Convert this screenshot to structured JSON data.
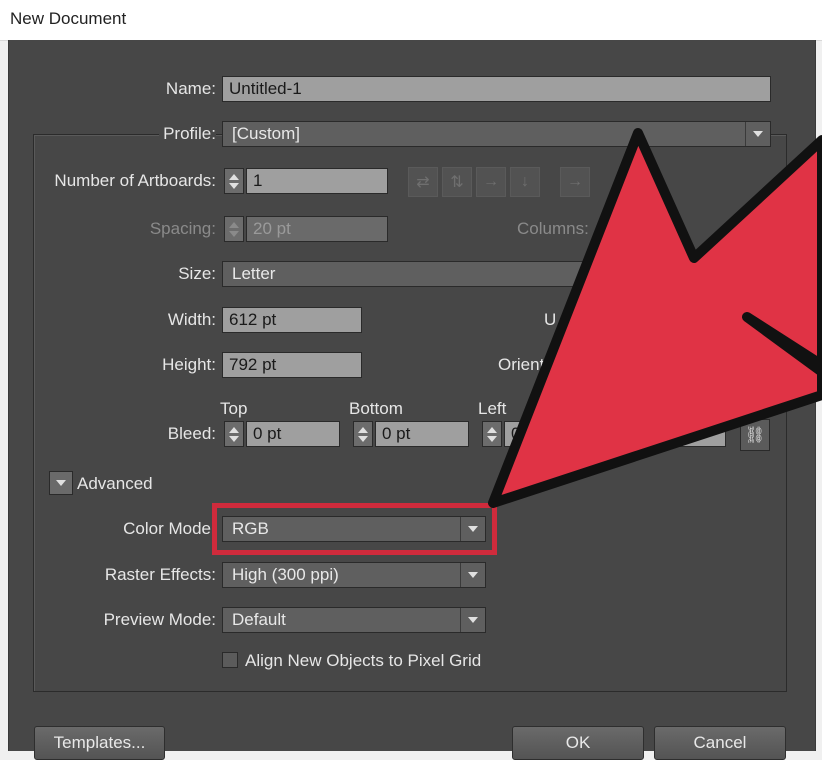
{
  "window": {
    "title": "New Document"
  },
  "name": {
    "label": "Name:",
    "value": "Untitled-1"
  },
  "profile": {
    "label": "Profile:",
    "value": "[Custom]"
  },
  "artboards": {
    "label": "Number of Artboards:",
    "value": "1"
  },
  "spacing": {
    "label": "Spacing:",
    "value": "20 pt"
  },
  "columns": {
    "label": "Columns:"
  },
  "size": {
    "label": "Size:",
    "value": "Letter"
  },
  "width": {
    "label": "Width:",
    "value": "612 pt"
  },
  "units": {
    "label_partial": "U"
  },
  "height": {
    "label": "Height:",
    "value": "792 pt"
  },
  "orientation": {
    "label_partial": "Orient"
  },
  "bleed": {
    "label": "Bleed:",
    "top_label": "Top",
    "top_value": "0 pt",
    "bottom_label": "Bottom",
    "bottom_value": "0 pt",
    "left_label": "Left",
    "left_value_partial": "0"
  },
  "advanced": {
    "label": "Advanced"
  },
  "color_mode": {
    "label": "Color Mode",
    "value": "RGB"
  },
  "raster_effects": {
    "label": "Raster Effects:",
    "value": "High (300 ppi)"
  },
  "preview_mode": {
    "label": "Preview Mode:",
    "value": "Default"
  },
  "align_pixel_grid": {
    "label": "Align New Objects to Pixel Grid",
    "checked": false
  },
  "buttons": {
    "templates": "Templates...",
    "ok": "OK",
    "cancel": "Cancel"
  },
  "colors": {
    "dialog_bg": "#474747",
    "field_bg": "#9f9f9f",
    "highlight": "#d02b3c",
    "arrow": "#e03345"
  }
}
